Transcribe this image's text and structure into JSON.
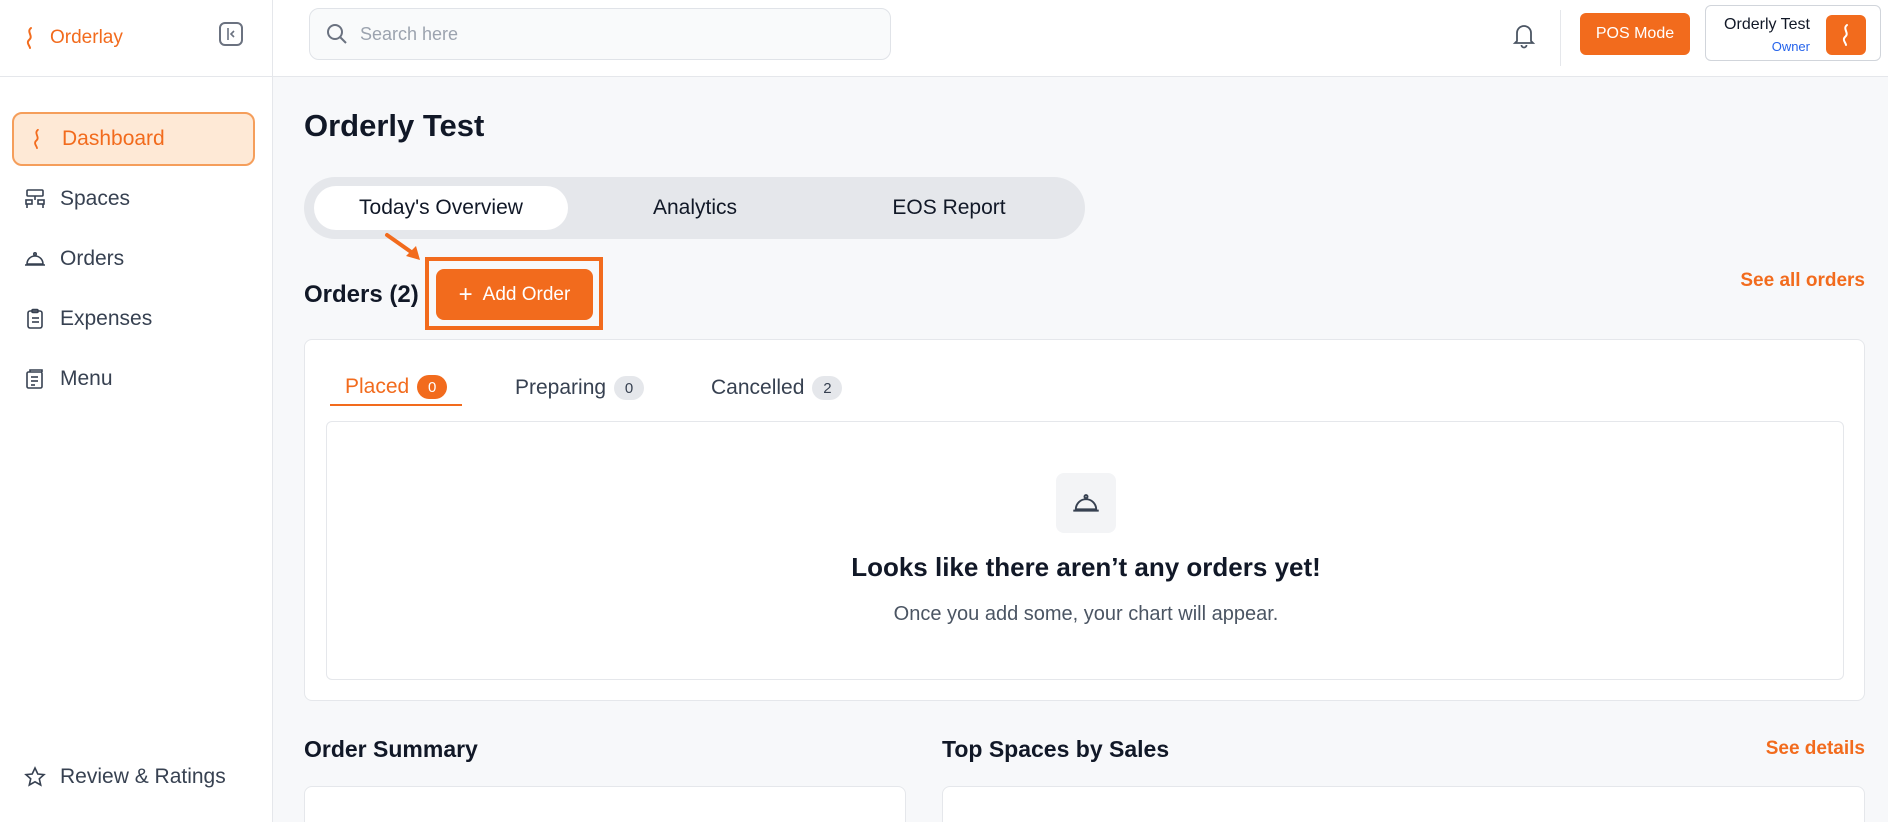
{
  "brand": {
    "name": "Orderlay",
    "accent": "#f26b1d"
  },
  "sidebar": {
    "items": [
      {
        "label": "Dashboard",
        "icon": "orderlay-logo-icon",
        "active": true
      },
      {
        "label": "Spaces",
        "icon": "spaces-icon"
      },
      {
        "label": "Orders",
        "icon": "cloche-icon"
      },
      {
        "label": "Expenses",
        "icon": "clipboard-icon"
      },
      {
        "label": "Menu",
        "icon": "menu-book-icon"
      }
    ],
    "bottom_item": {
      "label": "Review & Ratings",
      "icon": "star-icon"
    }
  },
  "topbar": {
    "search_placeholder": "Search here",
    "pos_label": "POS Mode",
    "profile_name": "Orderly Test",
    "profile_role": "Owner"
  },
  "main": {
    "title": "Orderly Test",
    "tabs": [
      {
        "label": "Today's Overview",
        "active": true
      },
      {
        "label": "Analytics"
      },
      {
        "label": "EOS Report"
      }
    ],
    "orders_heading": "Orders (2)",
    "add_order_label": "Add Order",
    "see_all_label": "See all orders",
    "status_tabs": [
      {
        "label": "Placed",
        "count": "0",
        "active": true
      },
      {
        "label": "Preparing",
        "count": "0"
      },
      {
        "label": "Cancelled",
        "count": "2"
      }
    ],
    "empty_title": "Looks like there aren’t any orders yet!",
    "empty_subtitle": "Once you add some, your chart will appear.",
    "order_summary_title": "Order Summary",
    "top_spaces_title": "Top Spaces by Sales",
    "see_details_label": "See details"
  }
}
